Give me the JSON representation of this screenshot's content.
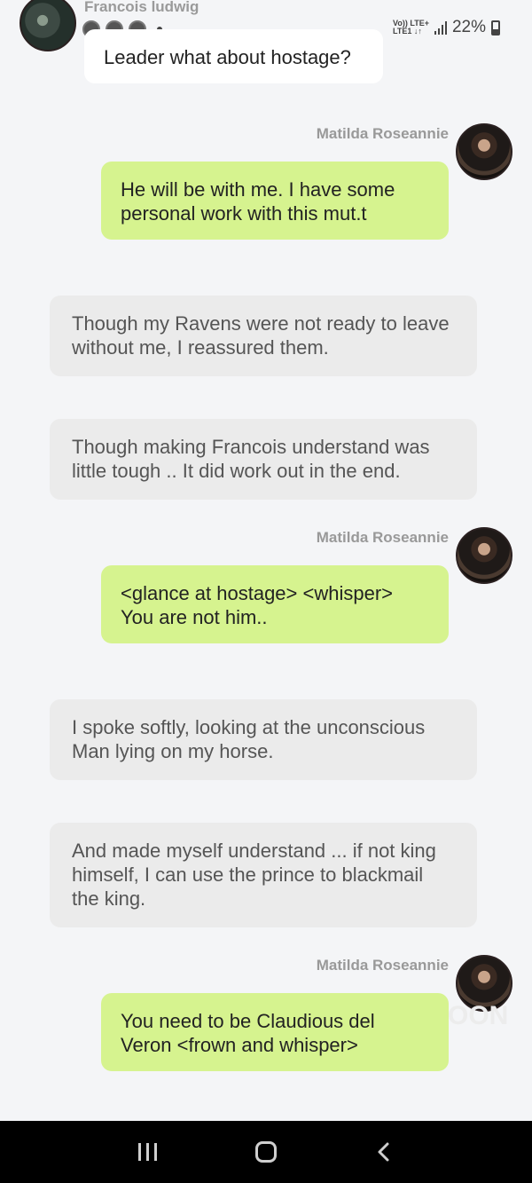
{
  "header": {
    "character_name": "Francois ludwig",
    "message": "Leader what about hostage?"
  },
  "status_bar": {
    "network_top": "Vo)) LTE+",
    "network_bottom": "LTE1 ↓↑",
    "battery": "22%"
  },
  "messages": [
    {
      "type": "user",
      "speaker": "Matilda Roseannie",
      "text": "He will be with me. I have some personal work with this mut.t"
    },
    {
      "type": "narration",
      "text": "Though my Ravens were not ready to leave without me, I reassured them."
    },
    {
      "type": "narration",
      "text": "Though making Francois understand was little tough .. It did work out in the end."
    },
    {
      "type": "user",
      "speaker": "Matilda Roseannie",
      "text": "<glance at hostage> <whisper> You are not him.."
    },
    {
      "type": "narration",
      "text": "I spoke softly, looking at the unconscious Man lying on my horse."
    },
    {
      "type": "narration",
      "text": "And made myself understand ... if not king himself, I can use the prince to blackmail the king."
    },
    {
      "type": "user",
      "speaker": "Matilda Roseannie",
      "text": "You need to be Claudious del Veron <frown and whisper>"
    }
  ],
  "watermark": "OON",
  "nav": {
    "icons": [
      "recent-apps-icon",
      "home-icon",
      "back-icon"
    ]
  }
}
